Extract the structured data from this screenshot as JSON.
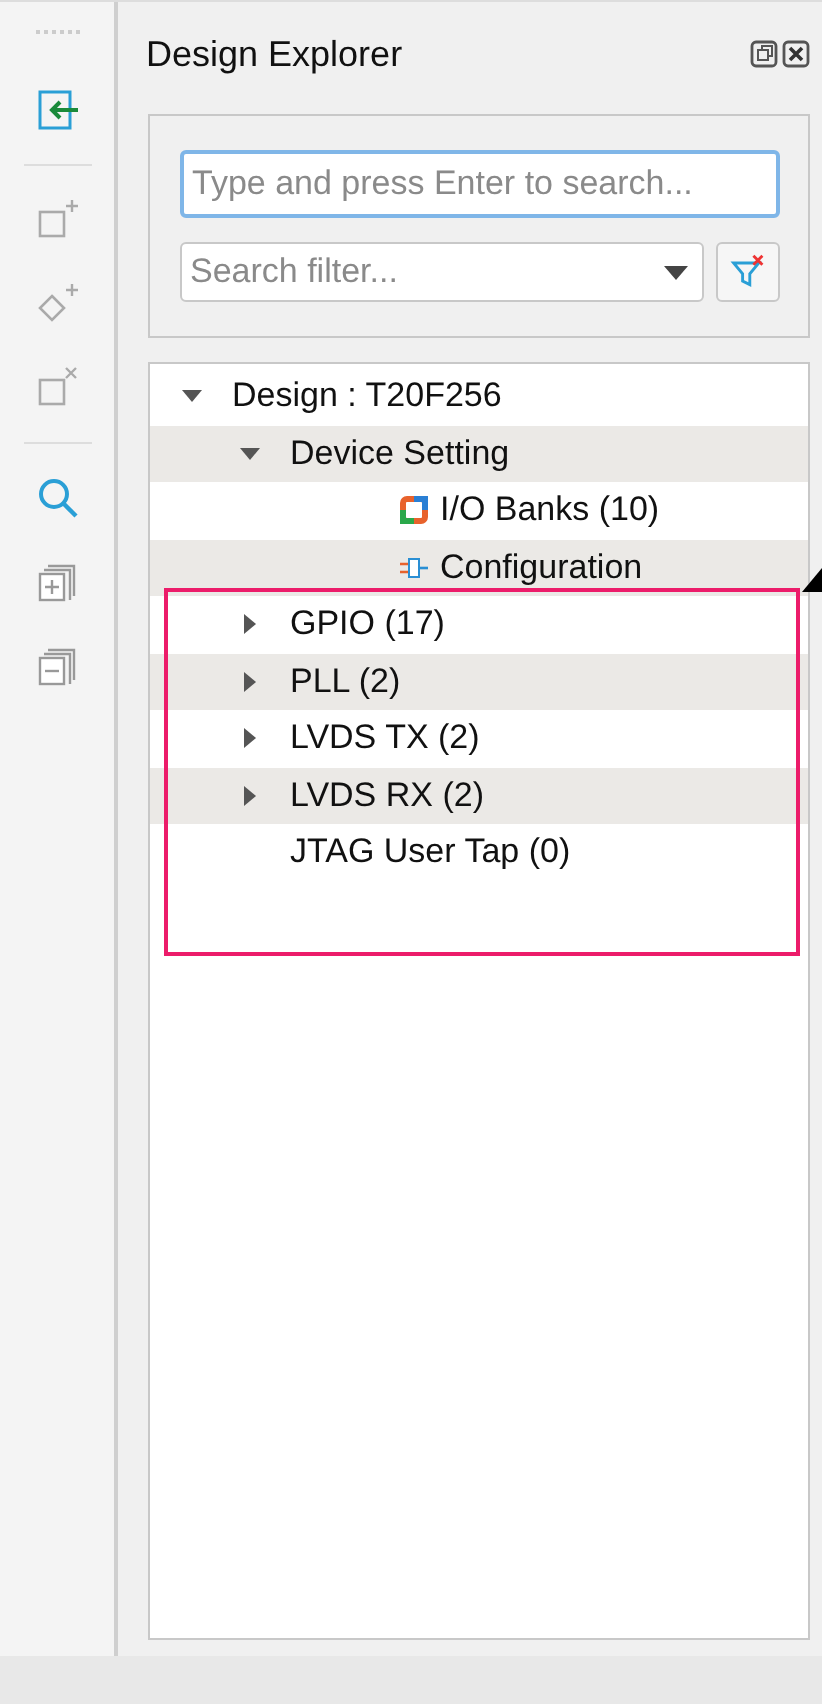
{
  "panel": {
    "title": "Design Explorer"
  },
  "search": {
    "placeholder": "Type and press Enter to search..."
  },
  "filter": {
    "placeholder": "Search filter..."
  },
  "tree": [
    {
      "label": "Design : T20F256",
      "kind": "branch",
      "expanded": true,
      "children": [
        {
          "label": "Device Setting",
          "kind": "branch",
          "expanded": true,
          "children": [
            {
              "label": "I/O Banks (10)",
              "kind": "io-bank"
            },
            {
              "label": "Configuration",
              "kind": "config"
            }
          ]
        },
        {
          "label": "GPIO (17)",
          "kind": "branch",
          "expanded": false
        },
        {
          "label": "PLL (2)",
          "kind": "branch",
          "expanded": false
        },
        {
          "label": "LVDS TX (2)",
          "kind": "branch",
          "expanded": false
        },
        {
          "label": "LVDS RX (2)",
          "kind": "branch",
          "expanded": false
        },
        {
          "label": "JTAG User Tap (0)",
          "kind": "leaf"
        }
      ]
    }
  ]
}
